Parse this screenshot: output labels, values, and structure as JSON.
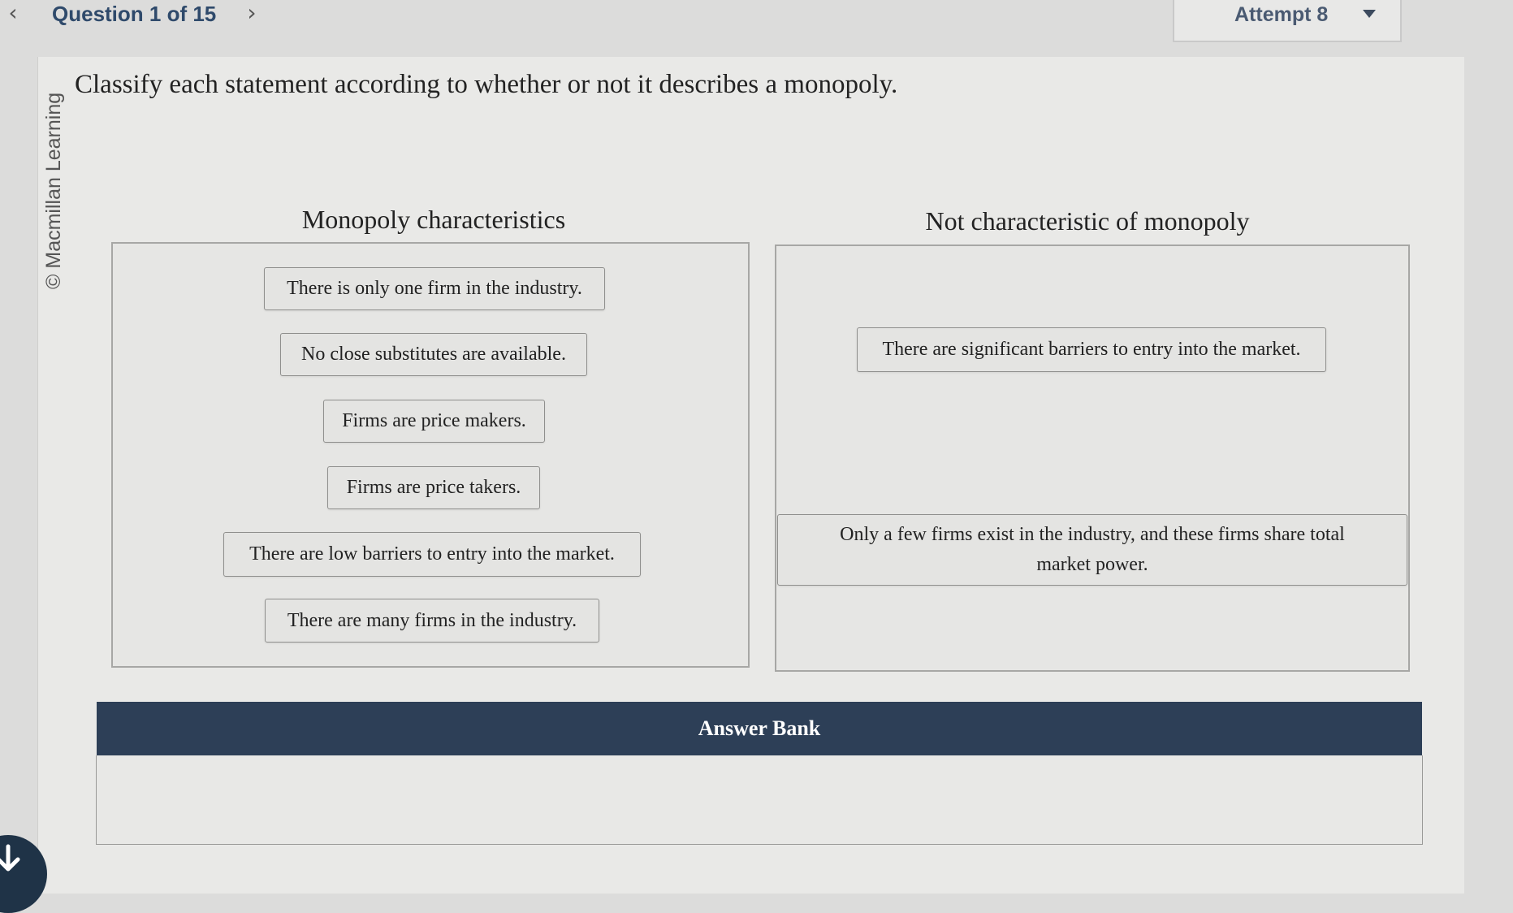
{
  "nav": {
    "question_counter": "Question 1 of 15",
    "prev_icon": "chevron-left-icon",
    "next_icon": "chevron-right-icon"
  },
  "attempt": {
    "label": "Attempt 8",
    "icon": "caret-down-icon"
  },
  "copyright": "© Macmillan Learning",
  "prompt": "Classify each statement according to whether or not it describes a monopoly.",
  "bins": [
    {
      "title": "Monopoly characteristics",
      "cards": [
        "There is only one firm in the industry.",
        "No close substitutes are available.",
        "Firms are price makers.",
        "Firms are price takers.",
        "There are low barriers to entry into the market.",
        "There are many firms in the industry."
      ]
    },
    {
      "title": "Not characteristic of monopoly",
      "cards": [
        "There are significant barriers to entry into the market.",
        "Only a few firms exist in the industry, and these firms share total market power."
      ]
    }
  ],
  "answer_bank": {
    "title": "Answer Bank",
    "items": []
  },
  "colors": {
    "brand_navy": "#2d3f57",
    "nav_text": "#2f4a6b"
  }
}
